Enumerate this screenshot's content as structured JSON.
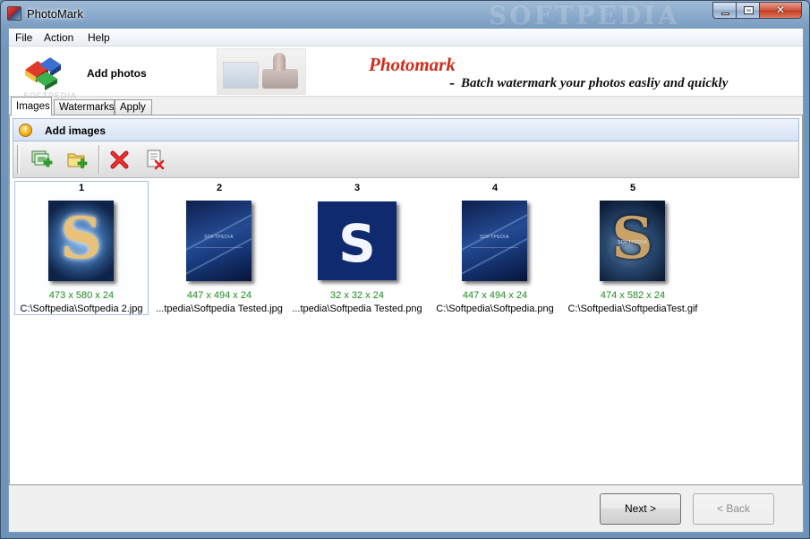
{
  "window": {
    "title": "PhotoMark",
    "watermark": "SOFTPEDIA"
  },
  "menu": {
    "file": "File",
    "action": "Action",
    "help": "Help"
  },
  "banner": {
    "step_title": "Add photos",
    "brand": "Photomark",
    "dash": "-",
    "slogan": "Batch watermark your photos easliy and quickly",
    "faded_text": "SOFTPEDIA"
  },
  "tabs": [
    {
      "label": "Images",
      "active": true
    },
    {
      "label": "Watermarks",
      "active": false
    },
    {
      "label": "Apply",
      "active": false
    }
  ],
  "section": {
    "icon": "warning-icon",
    "icon_glyph": "!",
    "title": "Add images"
  },
  "toolbar": {
    "buttons": [
      {
        "icon": "add-images-icon"
      },
      {
        "icon": "add-folder-icon"
      },
      {
        "icon": "delete-icon"
      },
      {
        "icon": "clear-list-icon"
      }
    ]
  },
  "thumbnails": [
    {
      "number": "1",
      "dims": "473 x 580 x 24",
      "path": "C:\\Softpedia\\Softpedia 2.jpg",
      "selected": true
    },
    {
      "number": "2",
      "dims": "447 x 494 x 24",
      "path": "...tpedia\\Softpedia Tested.jpg",
      "selected": false,
      "label": "SOFTPEDIA"
    },
    {
      "number": "3",
      "dims": "32 x 32 x 24",
      "path": "...tpedia\\Softpedia Tested.png",
      "selected": false
    },
    {
      "number": "4",
      "dims": "447 x 494 x 24",
      "path": "C:\\Softpedia\\Softpedia.png",
      "selected": false,
      "label": "SOFTPEDIA"
    },
    {
      "number": "5",
      "dims": "474 x 582 x 24",
      "path": "C:\\Softpedia\\SoftpediaTest.gif",
      "selected": false,
      "label": "SOFTPEDIA"
    }
  ],
  "buttons": {
    "next": "Next >",
    "back": "< Back"
  },
  "colors": {
    "brand_red": "#d42b1a",
    "dims_green": "#1f8a1f",
    "header_blue": "#d5e2f5"
  }
}
